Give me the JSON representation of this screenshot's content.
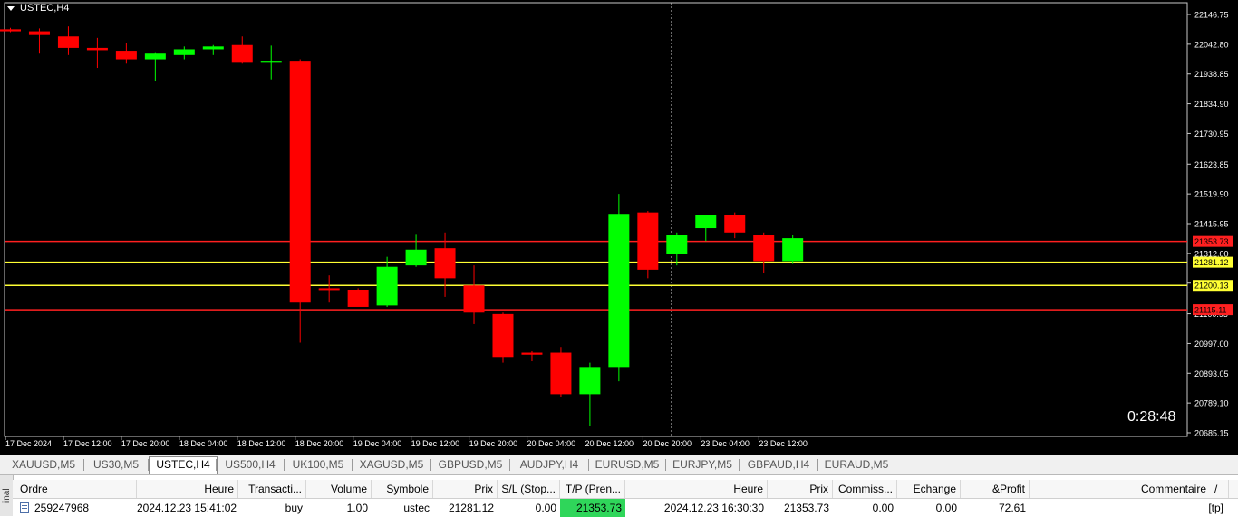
{
  "chart": {
    "symbol_title": "USTEC,H4",
    "countdown": "0:28:48",
    "price_axis": [
      "22146.75",
      "22042.80",
      "21938.85",
      "21834.90",
      "21730.95",
      "21623.85",
      "21519.90",
      "21415.95",
      "21312.00",
      "21208.05",
      "21100.95",
      "20997.00",
      "20893.05",
      "20789.10",
      "20685.15"
    ],
    "time_axis": [
      "17 Dec 2024",
      "17 Dec 12:00",
      "17 Dec 20:00",
      "18 Dec 04:00",
      "18 Dec 12:00",
      "18 Dec 20:00",
      "19 Dec 04:00",
      "19 Dec 12:00",
      "19 Dec 20:00",
      "20 Dec 04:00",
      "20 Dec 12:00",
      "20 Dec 20:00",
      "23 Dec 04:00",
      "23 Dec 12:00"
    ],
    "level_lines": [
      {
        "price": "21353.73",
        "color": "#ff2020"
      },
      {
        "price": "21281.12",
        "color": "#ffff33"
      },
      {
        "price": "21200.13",
        "color": "#ffff33"
      },
      {
        "price": "21115.11",
        "color": "#ff2020"
      }
    ],
    "candles": [
      {
        "o": 22095,
        "h": 22100,
        "l": 22085,
        "c": 22088
      },
      {
        "o": 22088,
        "h": 22098,
        "l": 22010,
        "c": 22075
      },
      {
        "o": 22070,
        "h": 22105,
        "l": 22005,
        "c": 22030
      },
      {
        "o": 22030,
        "h": 22065,
        "l": 21960,
        "c": 22022
      },
      {
        "o": 22020,
        "h": 22048,
        "l": 21975,
        "c": 21990
      },
      {
        "o": 21990,
        "h": 22015,
        "l": 21915,
        "c": 22010
      },
      {
        "o": 22005,
        "h": 22035,
        "l": 21990,
        "c": 22025
      },
      {
        "o": 22025,
        "h": 22040,
        "l": 22005,
        "c": 22035
      },
      {
        "o": 22040,
        "h": 22070,
        "l": 21975,
        "c": 21978
      },
      {
        "o": 21978,
        "h": 22038,
        "l": 21920,
        "c": 21985
      },
      {
        "o": 21985,
        "h": 21990,
        "l": 21000,
        "c": 21140
      },
      {
        "o": 21190,
        "h": 21235,
        "l": 21140,
        "c": 21188
      },
      {
        "o": 21185,
        "h": 21190,
        "l": 21130,
        "c": 21125
      },
      {
        "o": 21130,
        "h": 21300,
        "l": 21125,
        "c": 21265
      },
      {
        "o": 21270,
        "h": 21380,
        "l": 21265,
        "c": 21325
      },
      {
        "o": 21330,
        "h": 21385,
        "l": 21160,
        "c": 21225
      },
      {
        "o": 21200,
        "h": 21270,
        "l": 21065,
        "c": 21105
      },
      {
        "o": 21100,
        "h": 21105,
        "l": 20930,
        "c": 20950
      },
      {
        "o": 20965,
        "h": 20970,
        "l": 20935,
        "c": 20958
      },
      {
        "o": 20965,
        "h": 20985,
        "l": 20810,
        "c": 20820
      },
      {
        "o": 20820,
        "h": 20930,
        "l": 20710,
        "c": 20915
      },
      {
        "o": 20915,
        "h": 21520,
        "l": 20865,
        "c": 21450
      },
      {
        "o": 21455,
        "h": 21460,
        "l": 21225,
        "c": 21255
      },
      {
        "o": 21310,
        "h": 21385,
        "l": 21270,
        "c": 21375
      },
      {
        "o": 21400,
        "h": 21425,
        "l": 21355,
        "c": 21445
      },
      {
        "o": 21445,
        "h": 21455,
        "l": 21365,
        "c": 21385
      },
      {
        "o": 21375,
        "h": 21385,
        "l": 21245,
        "c": 21285
      },
      {
        "o": 21285,
        "h": 21375,
        "l": 21275,
        "c": 21365
      }
    ]
  },
  "tabs": [
    {
      "label": "XAUUSD,M5",
      "active": false
    },
    {
      "label": "US30,M5",
      "active": false
    },
    {
      "label": "USTEC,H4",
      "active": true
    },
    {
      "label": "US500,H4",
      "active": false
    },
    {
      "label": "UK100,M5",
      "active": false
    },
    {
      "label": "XAGUSD,M5",
      "active": false
    },
    {
      "label": "GBPUSD,M5",
      "active": false
    },
    {
      "label": "AUDJPY,H4",
      "active": false
    },
    {
      "label": "EURUSD,M5",
      "active": false
    },
    {
      "label": "EURJPY,M5",
      "active": false
    },
    {
      "label": "GBPAUD,H4",
      "active": false
    },
    {
      "label": "EURAUD,M5",
      "active": false
    }
  ],
  "terminal": {
    "side_label": "inal",
    "headers": [
      "Ordre",
      "Heure",
      "Transacti...",
      "Volume",
      "Symbole",
      "Prix",
      "S/L (Stop...",
      "T/P (Pren...",
      "Heure",
      "Prix",
      "Commiss...",
      "Echange",
      "&Profit",
      "Commentaire"
    ],
    "sort_indicator": "/",
    "row": [
      "259247968",
      "2024.12.23 15:41:02",
      "buy",
      "1.00",
      "ustec",
      "21281.12",
      "0.00",
      "21353.73",
      "2024.12.23 16:30:30",
      "21353.73",
      "0.00",
      "0.00",
      "72.61",
      "[tp]"
    ]
  },
  "colors": {
    "bull": "#00ff00",
    "bear": "#ff0000",
    "background": "#000000",
    "axis_text": "#ffffff",
    "tp_highlight": "#2fd65a"
  }
}
